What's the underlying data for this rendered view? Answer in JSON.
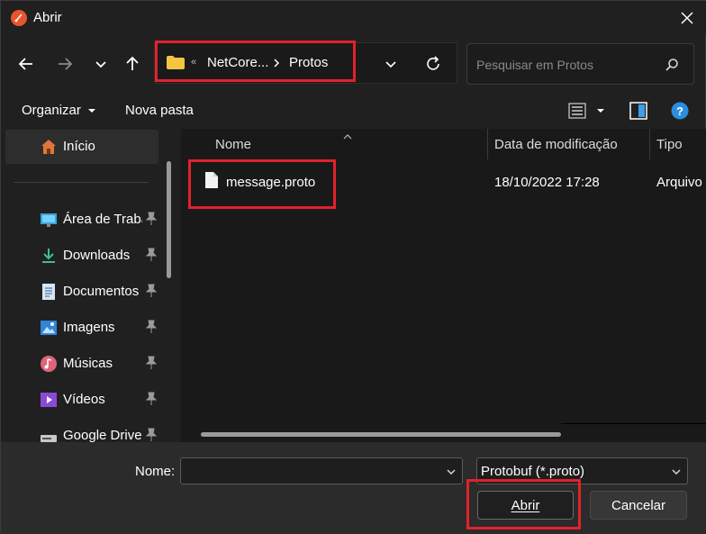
{
  "window": {
    "title": "Abrir",
    "colors": {
      "background": "#202020",
      "highlight": "#e1222a",
      "folder": "#f4c542"
    }
  },
  "address_bar": {
    "overflow": "«",
    "crumbs": [
      "NetCore...",
      "Protos"
    ]
  },
  "search": {
    "placeholder": "Pesquisar em Protos"
  },
  "command_bar": {
    "organize": "Organizar",
    "new_folder": "Nova pasta"
  },
  "sidebar": {
    "items": [
      {
        "label": "Início",
        "icon": "home-icon"
      },
      {
        "label": "Área de Trabalho",
        "icon": "desktop-icon"
      },
      {
        "label": "Downloads",
        "icon": "download-icon"
      },
      {
        "label": "Documentos",
        "icon": "document-icon"
      },
      {
        "label": "Imagens",
        "icon": "image-icon"
      },
      {
        "label": "Músicas",
        "icon": "music-icon"
      },
      {
        "label": "Vídeos",
        "icon": "video-icon"
      },
      {
        "label": "Google Drive",
        "icon": "drive-icon"
      }
    ]
  },
  "file_list": {
    "columns": [
      "Nome",
      "Data de modificação",
      "Tipo"
    ],
    "rows": [
      {
        "name": "message.proto",
        "modified": "18/10/2022 17:28",
        "type": "Arquivo"
      }
    ]
  },
  "footer": {
    "name_label": "Nome:",
    "name_value": "",
    "filter": "Protobuf (*.proto)",
    "open_button": "Abrir",
    "cancel_button": "Cancelar"
  }
}
